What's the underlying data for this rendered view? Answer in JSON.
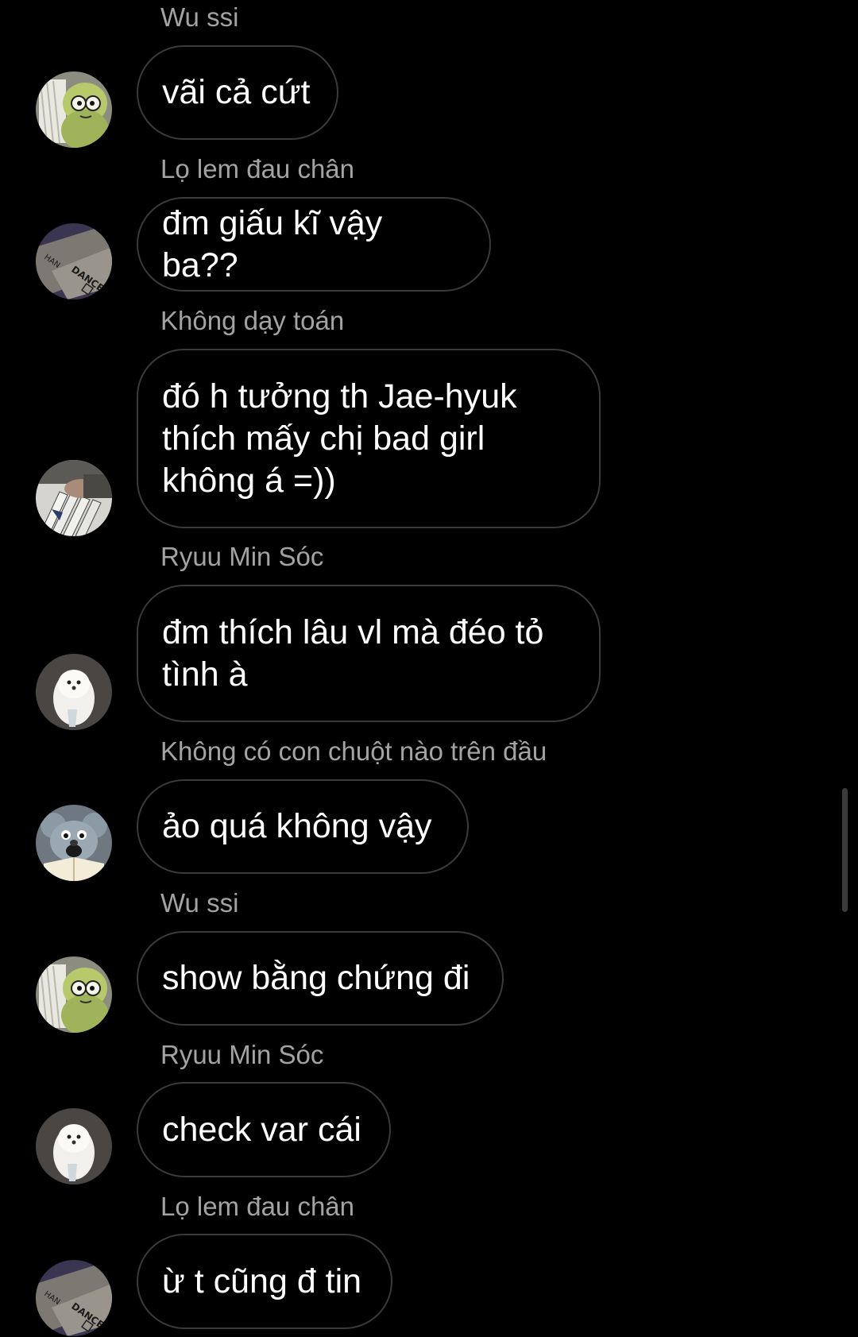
{
  "messages": [
    {
      "sender": "Wu ssi",
      "text": "vãi cả cứt",
      "avatar": "frog-avatar-icon"
    },
    {
      "sender": "Lọ lem đau chân",
      "text": "đm giấu kĩ vậy ba??",
      "avatar": "dance-poster-avatar-icon"
    },
    {
      "sender": "Không dạy toán",
      "text": "đó h tưởng th Jae-hyuk\nthích mấy chị bad girl\nkhông á =))",
      "avatar": "records-avatar-icon"
    },
    {
      "sender": "Ryuu Min Sóc",
      "text": "đm thích lâu vl mà đéo tỏ\ntình à",
      "avatar": "white-dog-avatar-icon"
    },
    {
      "sender": "Không có con chuột nào trên đầu",
      "text": "ảo quá không vậy",
      "avatar": "rat-avatar-icon"
    },
    {
      "sender": "Wu ssi",
      "text": "show bằng chứng đi",
      "avatar": "frog-avatar-icon"
    },
    {
      "sender": "Ryuu Min Sóc",
      "text": "check var cái",
      "avatar": "white-dog-avatar-icon"
    },
    {
      "sender": "Lọ lem đau chân",
      "text": "ừ t cũng đ tin",
      "avatar": "dance-poster-avatar-icon"
    }
  ],
  "avatar_label_text": "DANCE",
  "avatar_label_text2": "HAN",
  "colors": {
    "background": "#000000",
    "sender_name": "#a3a3a3",
    "bubble_border": "#3a3a3a",
    "message_text": "#ffffff"
  }
}
